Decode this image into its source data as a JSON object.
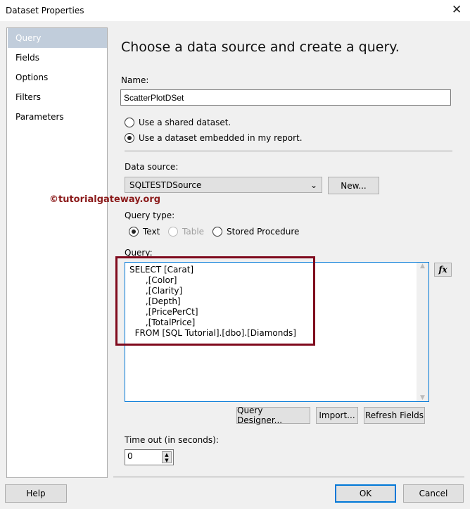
{
  "window": {
    "title": "Dataset Properties",
    "close": "✕"
  },
  "sidebar": {
    "items": [
      {
        "label": "Query",
        "selected": true
      },
      {
        "label": "Fields"
      },
      {
        "label": "Options"
      },
      {
        "label": "Filters"
      },
      {
        "label": "Parameters"
      }
    ]
  },
  "main": {
    "heading": "Choose a data source and create a query.",
    "name_label": "Name:",
    "name_value": "ScatterPlotDSet",
    "radio_shared": "Use a shared dataset.",
    "radio_embedded": "Use a dataset embedded in my report.",
    "datasource_label": "Data source:",
    "datasource_value": "SQLTESTDSource",
    "new_button": "New...",
    "querytype_label": "Query type:",
    "qt_text": "Text",
    "qt_table": "Table",
    "qt_sp": "Stored Procedure",
    "query_label": "Query:",
    "query_lines": [
      "SELECT [Carat]",
      "      ,[Color]",
      "      ,[Clarity]",
      "      ,[Depth]",
      "      ,[PricePerCt]",
      "      ,[TotalPrice]",
      "  FROM [SQL Tutorial].[dbo].[Diamonds]"
    ],
    "fx_button": "fx",
    "query_designer": "Query Designer...",
    "import": "Import...",
    "refresh": "Refresh Fields",
    "timeout_label": "Time out (in seconds):",
    "timeout_value": "0"
  },
  "watermark": "©tutorialgateway.org",
  "footer": {
    "help": "Help",
    "ok": "OK",
    "cancel": "Cancel"
  }
}
